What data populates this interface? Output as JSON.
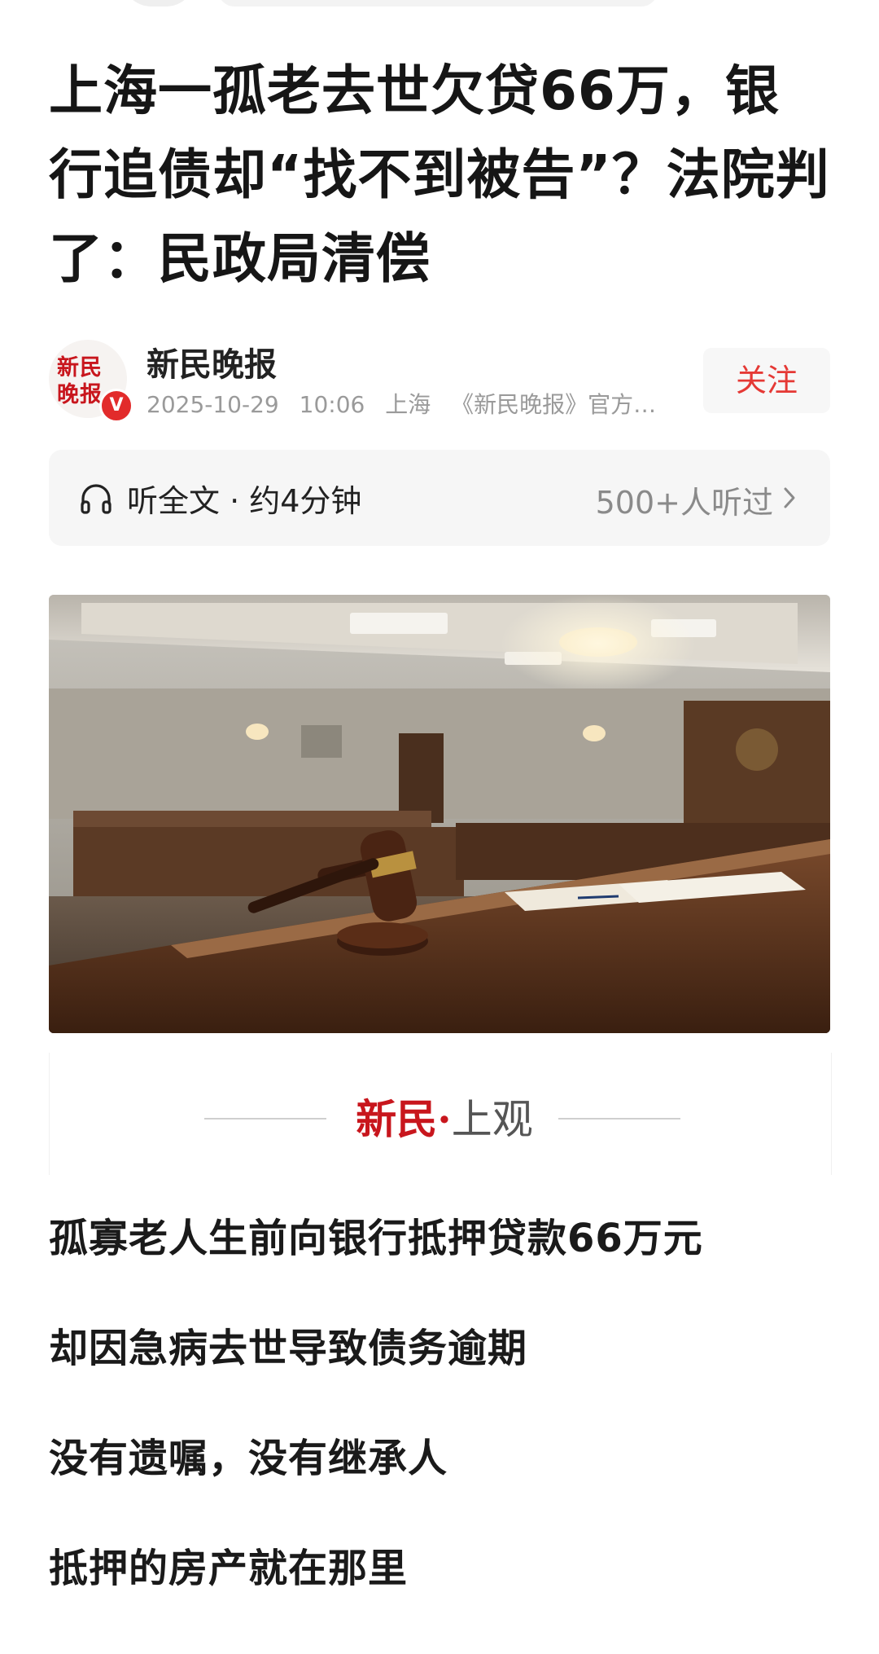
{
  "article": {
    "title": "上海一孤老去世欠贷66万，银行追债却“找不到被告”？法院判了：民政局清偿"
  },
  "author": {
    "name": "新民晚报",
    "avatar_logo": "新民晚报",
    "verified_badge": "V",
    "date": "2025-10-29",
    "time": "10:06",
    "location": "上海",
    "description": "《新民晚报》官方…",
    "follow_label": "关注"
  },
  "listen": {
    "label": "听全文 · 约4分钟",
    "count": "500+人听过",
    "icon": "headphones-icon"
  },
  "brand_band": {
    "logo_red": "新民",
    "logo_dot": "·",
    "logo_gray": "上观"
  },
  "paragraphs": [
    "孤寡老人生前向银行抵押贷款66万元",
    "却因急病去世导致债务逾期",
    "没有遗嘱，没有继承人",
    "抵押的房产就在那里"
  ],
  "colors": {
    "accent_red": "#e53935",
    "brand_red": "#c8161d",
    "meta_gray": "#9a9a9a"
  }
}
